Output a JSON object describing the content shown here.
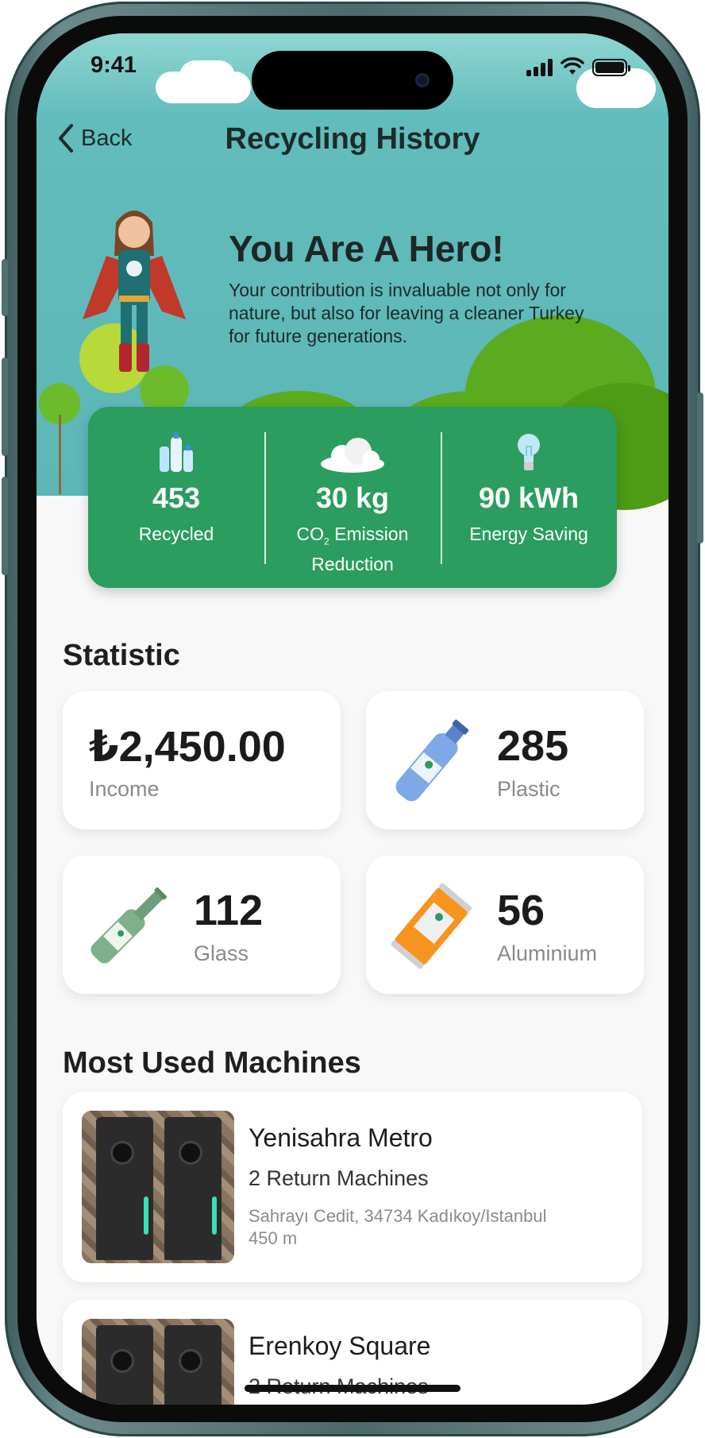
{
  "status_bar": {
    "time": "9:41"
  },
  "header": {
    "back_label": "Back",
    "title": "Recycling History"
  },
  "hero": {
    "title": "You Are A Hero!",
    "text": "Your contribution is invaluable not only for nature, but also for leaving a cleaner Turkey for future generations."
  },
  "impact": [
    {
      "value": "453",
      "label": "Recycled",
      "icon": "bottles-icon"
    },
    {
      "value": "30 kg",
      "label_main": "CO",
      "label_sub": "2",
      "label_rest": " Emission Reduction",
      "icon": "cloud-icon"
    },
    {
      "value": "90 kWh",
      "label": "Energy Saving",
      "icon": "lightbulb-icon"
    }
  ],
  "statistic": {
    "title": "Statistic",
    "income_value": "₺2,450.00",
    "income_label": "Income",
    "plastic_value": "285",
    "plastic_label": "Plastic",
    "glass_value": "112",
    "glass_label": "Glass",
    "aluminium_value": "56",
    "aluminium_label": "Aluminium"
  },
  "machines": {
    "title": "Most Used Machines",
    "items": [
      {
        "name": "Yenisahra Metro",
        "count": "2 Return Machines",
        "address": "Sahrayı Cedit, 34734 Kadıkoy/Istanbul",
        "distance": "450 m"
      },
      {
        "name": "Erenkoy Square",
        "count": "2 Return Machines"
      }
    ]
  },
  "colors": {
    "accent_green": "#2a9d5f",
    "sky": "#5db7b6",
    "background": "#f8f8f8"
  }
}
